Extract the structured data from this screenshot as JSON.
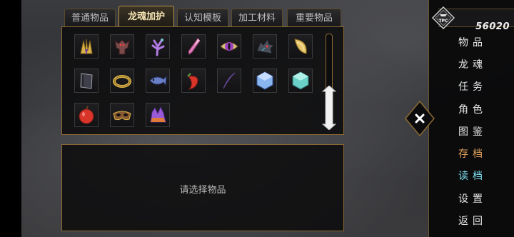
{
  "tabs": [
    {
      "label": "普通物品",
      "active": false
    },
    {
      "label": "龙魂加护",
      "active": true
    },
    {
      "label": "认知模板",
      "active": false
    },
    {
      "label": "加工材料",
      "active": false
    },
    {
      "label": "重要物品",
      "active": false
    }
  ],
  "inventory": {
    "items": [
      {
        "icon": "golden-claw-icon"
      },
      {
        "icon": "demon-statue-icon"
      },
      {
        "icon": "purple-coral-icon"
      },
      {
        "icon": "pink-crystal-icon"
      },
      {
        "icon": "dragon-eye-icon"
      },
      {
        "icon": "dragon-head-icon"
      },
      {
        "icon": "golden-scale-icon"
      },
      {
        "icon": "dark-book-icon"
      },
      {
        "icon": "gold-bracelet-icon"
      },
      {
        "icon": "blue-fish-icon"
      },
      {
        "icon": "red-pepper-icon"
      },
      {
        "icon": "purple-fang-icon"
      },
      {
        "icon": "blue-gem-icon"
      },
      {
        "icon": "teal-gem-icon"
      },
      {
        "icon": "red-apple-icon"
      },
      {
        "icon": "masquerade-mask-icon"
      },
      {
        "icon": "purple-crystal-cluster-icon"
      }
    ]
  },
  "description": {
    "placeholder": "请选择物品"
  },
  "currency": {
    "icon_label": "TPC",
    "value": "56020"
  },
  "menu": [
    {
      "label": "物品",
      "color": "#e6e6e6"
    },
    {
      "label": "龙魂",
      "color": "#e6e6e6"
    },
    {
      "label": "任务",
      "color": "#e6e6e6"
    },
    {
      "label": "角色",
      "color": "#e6e6e6"
    },
    {
      "label": "图鉴",
      "color": "#e6e6e6"
    },
    {
      "label": "存档",
      "color": "#e2a35c"
    },
    {
      "label": "读档",
      "color": "#7fe0ef"
    },
    {
      "label": "设置",
      "color": "#e6e6e6"
    },
    {
      "label": "返回",
      "color": "#e6e6e6"
    }
  ],
  "close_icon": "close-icon",
  "accent_color": "#b9934a"
}
